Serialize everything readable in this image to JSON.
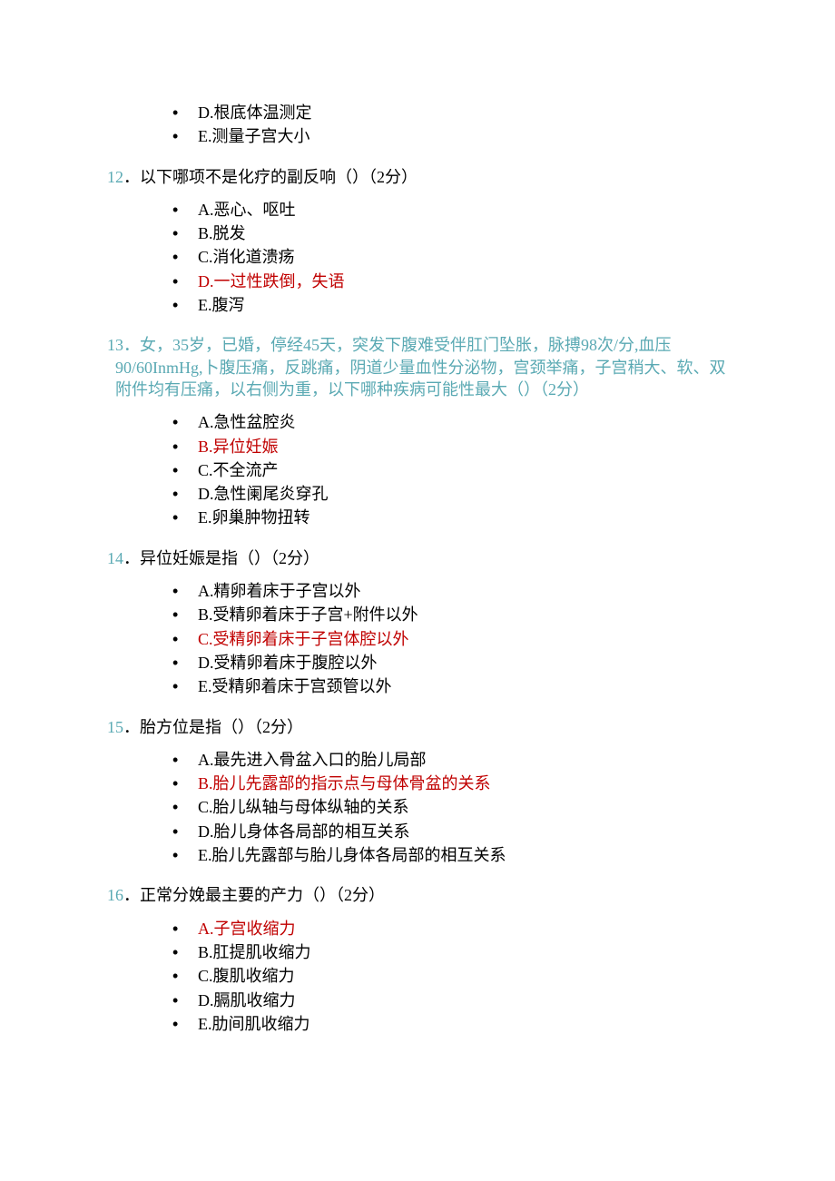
{
  "prev_options": [
    {
      "text": "D.根底体温测定",
      "answer": false
    },
    {
      "text": "E.测量子宫大小",
      "answer": false
    }
  ],
  "questions": [
    {
      "num": "12",
      "stem": "．以下哪项不是化疗的副反响（）（2分）",
      "stem_color": "black",
      "options": [
        {
          "text": "A.恶心、呕吐",
          "answer": false
        },
        {
          "text": "B.脱发",
          "answer": false
        },
        {
          "text": "C.消化道溃疡",
          "answer": false
        },
        {
          "text": "D.一过性跌倒，失语",
          "answer": true
        },
        {
          "text": "E.腹泻",
          "answer": false
        }
      ]
    },
    {
      "num": "13",
      "stem": "．女，35岁，已婚，停经45天，突发下腹难受伴肛门坠胀，脉搏98次/分,血压90/60InmHg,卜腹压痛，反跳痛，阴道少量血性分泌物，宫颈举痛，子宫稍大、软、双附件均有压痛，以右侧为重，以下哪种疾病可能性最大（）（2分）",
      "stem_color": "teal",
      "options": [
        {
          "text": "A.急性盆腔炎",
          "answer": false
        },
        {
          "text": "B.异位妊娠",
          "answer": true
        },
        {
          "text": "C.不全流产",
          "answer": false
        },
        {
          "text": "D.急性阑尾炎穿孔",
          "answer": false
        },
        {
          "text": "E.卵巢肿物扭转",
          "answer": false
        }
      ]
    },
    {
      "num": "14",
      "stem": "．异位妊娠是指（）（2分）",
      "stem_color": "black",
      "options": [
        {
          "text": "A.精卵着床于子宫以外",
          "answer": false
        },
        {
          "text": "B.受精卵着床于子宫+附件以外",
          "answer": false
        },
        {
          "text": "C.受精卵着床于子宫体腔以外",
          "answer": true
        },
        {
          "text": "D.受精卵着床于腹腔以外",
          "answer": false
        },
        {
          "text": "E.受精卵着床于宫颈管以外",
          "answer": false
        }
      ]
    },
    {
      "num": "15",
      "stem": "．胎方位是指（）（2分）",
      "stem_color": "black",
      "options": [
        {
          "text": "A.最先进入骨盆入口的胎儿局部",
          "answer": false
        },
        {
          "text": "B.胎儿先露部的指示点与母体骨盆的关系",
          "answer": true
        },
        {
          "text": "C.胎儿纵轴与母体纵轴的关系",
          "answer": false
        },
        {
          "text": "D.胎儿身体各局部的相互关系",
          "answer": false
        },
        {
          "text": "E.胎儿先露部与胎儿身体各局部的相互关系",
          "answer": false
        }
      ]
    },
    {
      "num": "16",
      "stem": "．正常分娩最主要的产力（）（2分）",
      "stem_color": "black",
      "options": [
        {
          "text": "A.子宫收缩力",
          "answer": true
        },
        {
          "text": "B.肛提肌收缩力",
          "answer": false
        },
        {
          "text": "C.腹肌收缩力",
          "answer": false
        },
        {
          "text": "D.膈肌收缩力",
          "answer": false
        },
        {
          "text": "E.肋间肌收缩力",
          "answer": false
        }
      ]
    }
  ]
}
